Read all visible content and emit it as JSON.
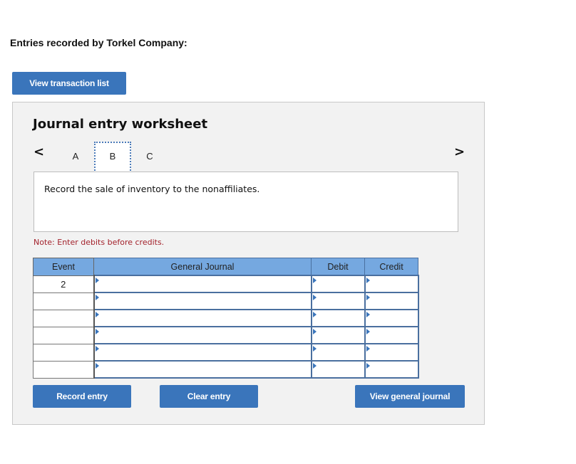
{
  "page": {
    "title": "Entries recorded by Torkel Company:"
  },
  "buttons": {
    "view_transaction_list": "View transaction list",
    "record_entry": "Record entry",
    "clear_entry": "Clear entry",
    "view_general_journal": "View general journal"
  },
  "worksheet": {
    "title": "Journal entry worksheet",
    "prev_icon": "chevron-left-icon",
    "next_icon": "chevron-right-icon",
    "prev_glyph": "<",
    "next_glyph": ">",
    "tabs": [
      {
        "label": "A",
        "active": false
      },
      {
        "label": "B",
        "active": true
      },
      {
        "label": "C",
        "active": false
      }
    ],
    "prompt": "Record the sale of inventory to the nonaffiliates.",
    "note": "Note: Enter debits before credits.",
    "colors": {
      "button": "#3a75bb",
      "header": "#75a8e0",
      "note": "#a3222c"
    }
  },
  "table": {
    "headers": {
      "event": "Event",
      "general_journal": "General Journal",
      "debit": "Debit",
      "credit": "Credit"
    },
    "rows": [
      {
        "event": "2",
        "account": "",
        "debit": "",
        "credit": ""
      },
      {
        "event": "",
        "account": "",
        "debit": "",
        "credit": ""
      },
      {
        "event": "",
        "account": "",
        "debit": "",
        "credit": ""
      },
      {
        "event": "",
        "account": "",
        "debit": "",
        "credit": ""
      },
      {
        "event": "",
        "account": "",
        "debit": "",
        "credit": ""
      },
      {
        "event": "",
        "account": "",
        "debit": "",
        "credit": ""
      }
    ]
  }
}
